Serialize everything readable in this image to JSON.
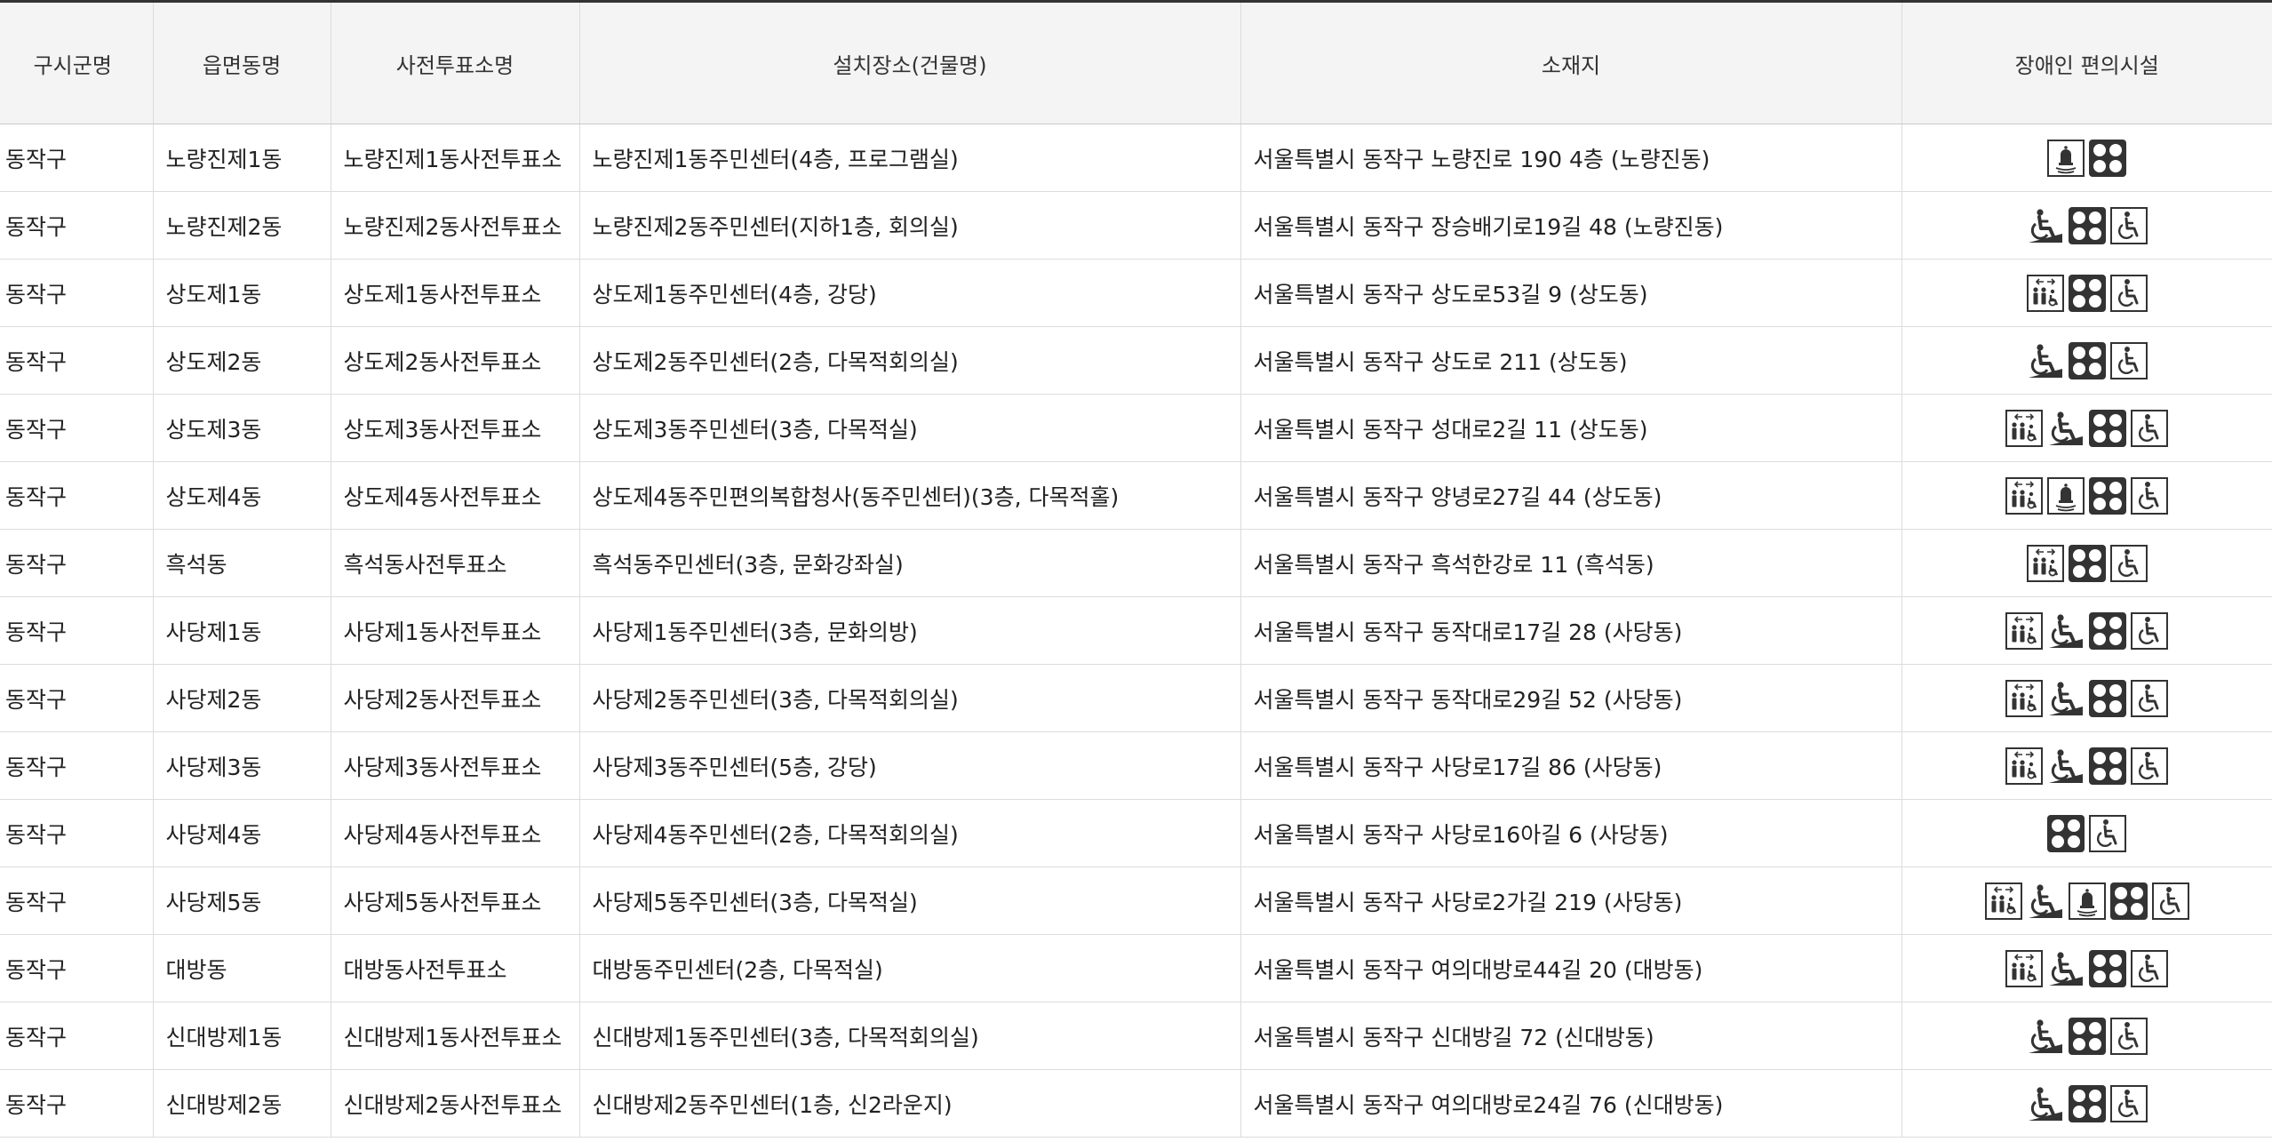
{
  "table": {
    "headers": [
      "구시군명",
      "읍면동명",
      "사전투표소명",
      "설치장소(건물명)",
      "소재지",
      "장애인 편의시설"
    ],
    "rows": [
      {
        "sigungu": "동작구",
        "dong": "노량진제1동",
        "station": "노량진제1동사전투표소",
        "place": "노량진제1동주민센터(4층, 프로그램실)",
        "address": "서울특별시 동작구 노량진로 190 4층 (노량진동)",
        "facilities": [
          "bell-icon",
          "braille-block-icon"
        ]
      },
      {
        "sigungu": "동작구",
        "dong": "노량진제2동",
        "station": "노량진제2동사전투표소",
        "place": "노량진제2동주민센터(지하1층, 회의실)",
        "address": "서울특별시 동작구 장승배기로19길 48 (노량진동)",
        "facilities": [
          "ramp-icon",
          "braille-block-icon",
          "wheelchair-icon"
        ]
      },
      {
        "sigungu": "동작구",
        "dong": "상도제1동",
        "station": "상도제1동사전투표소",
        "place": "상도제1동주민센터(4층, 강당)",
        "address": "서울특별시 동작구 상도로53길 9 (상도동)",
        "facilities": [
          "elevator-icon",
          "braille-block-icon",
          "wheelchair-icon"
        ]
      },
      {
        "sigungu": "동작구",
        "dong": "상도제2동",
        "station": "상도제2동사전투표소",
        "place": "상도제2동주민센터(2층, 다목적회의실)",
        "address": "서울특별시 동작구 상도로 211 (상도동)",
        "facilities": [
          "ramp-icon",
          "braille-block-icon",
          "wheelchair-icon"
        ]
      },
      {
        "sigungu": "동작구",
        "dong": "상도제3동",
        "station": "상도제3동사전투표소",
        "place": "상도제3동주민센터(3층, 다목적실)",
        "address": "서울특별시 동작구 성대로2길 11 (상도동)",
        "facilities": [
          "elevator-icon",
          "ramp-icon",
          "braille-block-icon",
          "wheelchair-icon"
        ]
      },
      {
        "sigungu": "동작구",
        "dong": "상도제4동",
        "station": "상도제4동사전투표소",
        "place": "상도제4동주민편의복합청사(동주민센터)(3층, 다목적홀)",
        "address": "서울특별시 동작구 양녕로27길 44 (상도동)",
        "facilities": [
          "elevator-icon",
          "bell-icon",
          "braille-block-icon",
          "wheelchair-icon"
        ]
      },
      {
        "sigungu": "동작구",
        "dong": "흑석동",
        "station": "흑석동사전투표소",
        "place": "흑석동주민센터(3층, 문화강좌실)",
        "address": "서울특별시 동작구 흑석한강로 11 (흑석동)",
        "facilities": [
          "elevator-icon",
          "braille-block-icon",
          "wheelchair-icon"
        ]
      },
      {
        "sigungu": "동작구",
        "dong": "사당제1동",
        "station": "사당제1동사전투표소",
        "place": "사당제1동주민센터(3층, 문화의방)",
        "address": "서울특별시 동작구 동작대로17길 28 (사당동)",
        "facilities": [
          "elevator-icon",
          "ramp-icon",
          "braille-block-icon",
          "wheelchair-icon"
        ]
      },
      {
        "sigungu": "동작구",
        "dong": "사당제2동",
        "station": "사당제2동사전투표소",
        "place": "사당제2동주민센터(3층, 다목적회의실)",
        "address": "서울특별시 동작구 동작대로29길 52 (사당동)",
        "facilities": [
          "elevator-icon",
          "ramp-icon",
          "braille-block-icon",
          "wheelchair-icon"
        ]
      },
      {
        "sigungu": "동작구",
        "dong": "사당제3동",
        "station": "사당제3동사전투표소",
        "place": "사당제3동주민센터(5층, 강당)",
        "address": "서울특별시 동작구 사당로17길 86 (사당동)",
        "facilities": [
          "elevator-icon",
          "ramp-icon",
          "braille-block-icon",
          "wheelchair-icon"
        ]
      },
      {
        "sigungu": "동작구",
        "dong": "사당제4동",
        "station": "사당제4동사전투표소",
        "place": "사당제4동주민센터(2층, 다목적회의실)",
        "address": "서울특별시 동작구 사당로16아길 6 (사당동)",
        "facilities": [
          "braille-block-icon",
          "wheelchair-icon"
        ]
      },
      {
        "sigungu": "동작구",
        "dong": "사당제5동",
        "station": "사당제5동사전투표소",
        "place": "사당제5동주민센터(3층, 다목적실)",
        "address": "서울특별시 동작구 사당로2가길 219 (사당동)",
        "facilities": [
          "elevator-icon",
          "ramp-icon",
          "bell-icon",
          "braille-block-icon",
          "wheelchair-icon"
        ]
      },
      {
        "sigungu": "동작구",
        "dong": "대방동",
        "station": "대방동사전투표소",
        "place": "대방동주민센터(2층, 다목적실)",
        "address": "서울특별시 동작구 여의대방로44길 20 (대방동)",
        "facilities": [
          "elevator-icon",
          "ramp-icon",
          "braille-block-icon",
          "wheelchair-icon"
        ]
      },
      {
        "sigungu": "동작구",
        "dong": "신대방제1동",
        "station": "신대방제1동사전투표소",
        "place": "신대방제1동주민센터(3층, 다목적회의실)",
        "address": "서울특별시 동작구 신대방길 72 (신대방동)",
        "facilities": [
          "ramp-icon",
          "braille-block-icon",
          "wheelchair-icon"
        ]
      },
      {
        "sigungu": "동작구",
        "dong": "신대방제2동",
        "station": "신대방제2동사전투표소",
        "place": "신대방제2동주민센터(1층, 신2라운지)",
        "address": "서울특별시 동작구 여의대방로24길 76 (신대방동)",
        "facilities": [
          "ramp-icon",
          "braille-block-icon",
          "wheelchair-icon"
        ]
      }
    ]
  }
}
